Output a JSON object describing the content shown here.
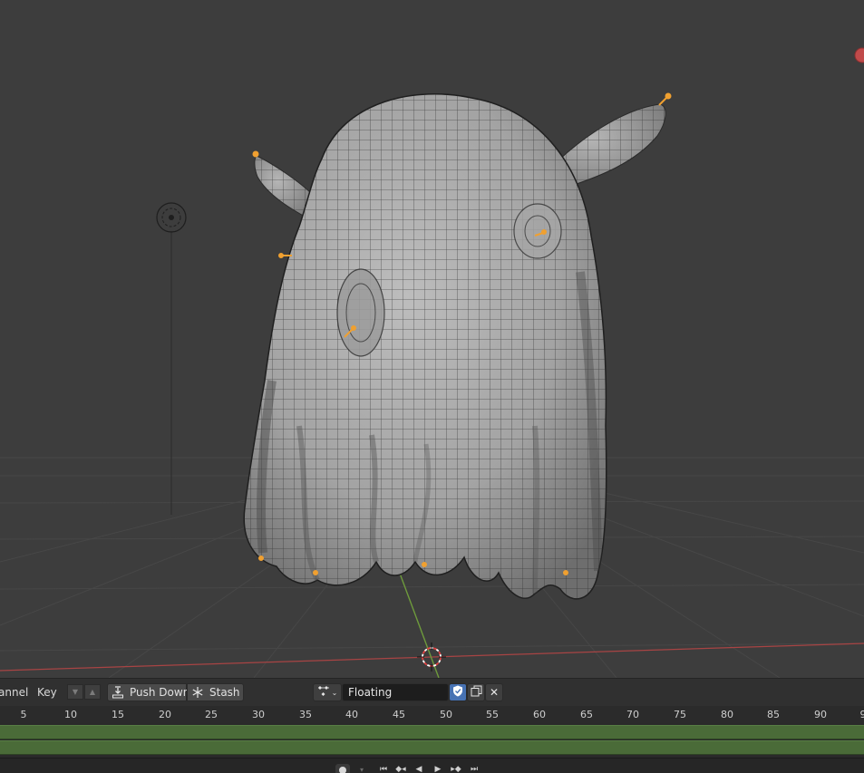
{
  "viewport": {
    "object": "ghost mesh",
    "gizmos": [
      "light-icon",
      "3d-cursor-icon",
      "axis-navigation-dot"
    ]
  },
  "nla_header": {
    "channel_menu": "annel",
    "key_menu": "Key",
    "push_down_label": "Push Down",
    "stash_label": "Stash",
    "action_name": "Floating"
  },
  "timeline": {
    "ticks": [
      "5",
      "10",
      "15",
      "20",
      "25",
      "30",
      "35",
      "40",
      "45",
      "50",
      "55",
      "60",
      "65",
      "70",
      "75",
      "80",
      "85",
      "90",
      "9"
    ]
  },
  "colors": {
    "viewport_bg": "#3d3d3d",
    "strip_green": "#4a6b38",
    "bone_orange": "#f0a030",
    "x_axis": "#b34848",
    "y_axis": "#6e9a3c",
    "shield_blue": "#4772b3"
  },
  "playback": {
    "buttons": [
      "record-icon",
      "jump-start-icon",
      "prev-keyframe-icon",
      "play-reverse-icon",
      "play-icon",
      "next-keyframe-icon",
      "jump-end-icon"
    ]
  }
}
